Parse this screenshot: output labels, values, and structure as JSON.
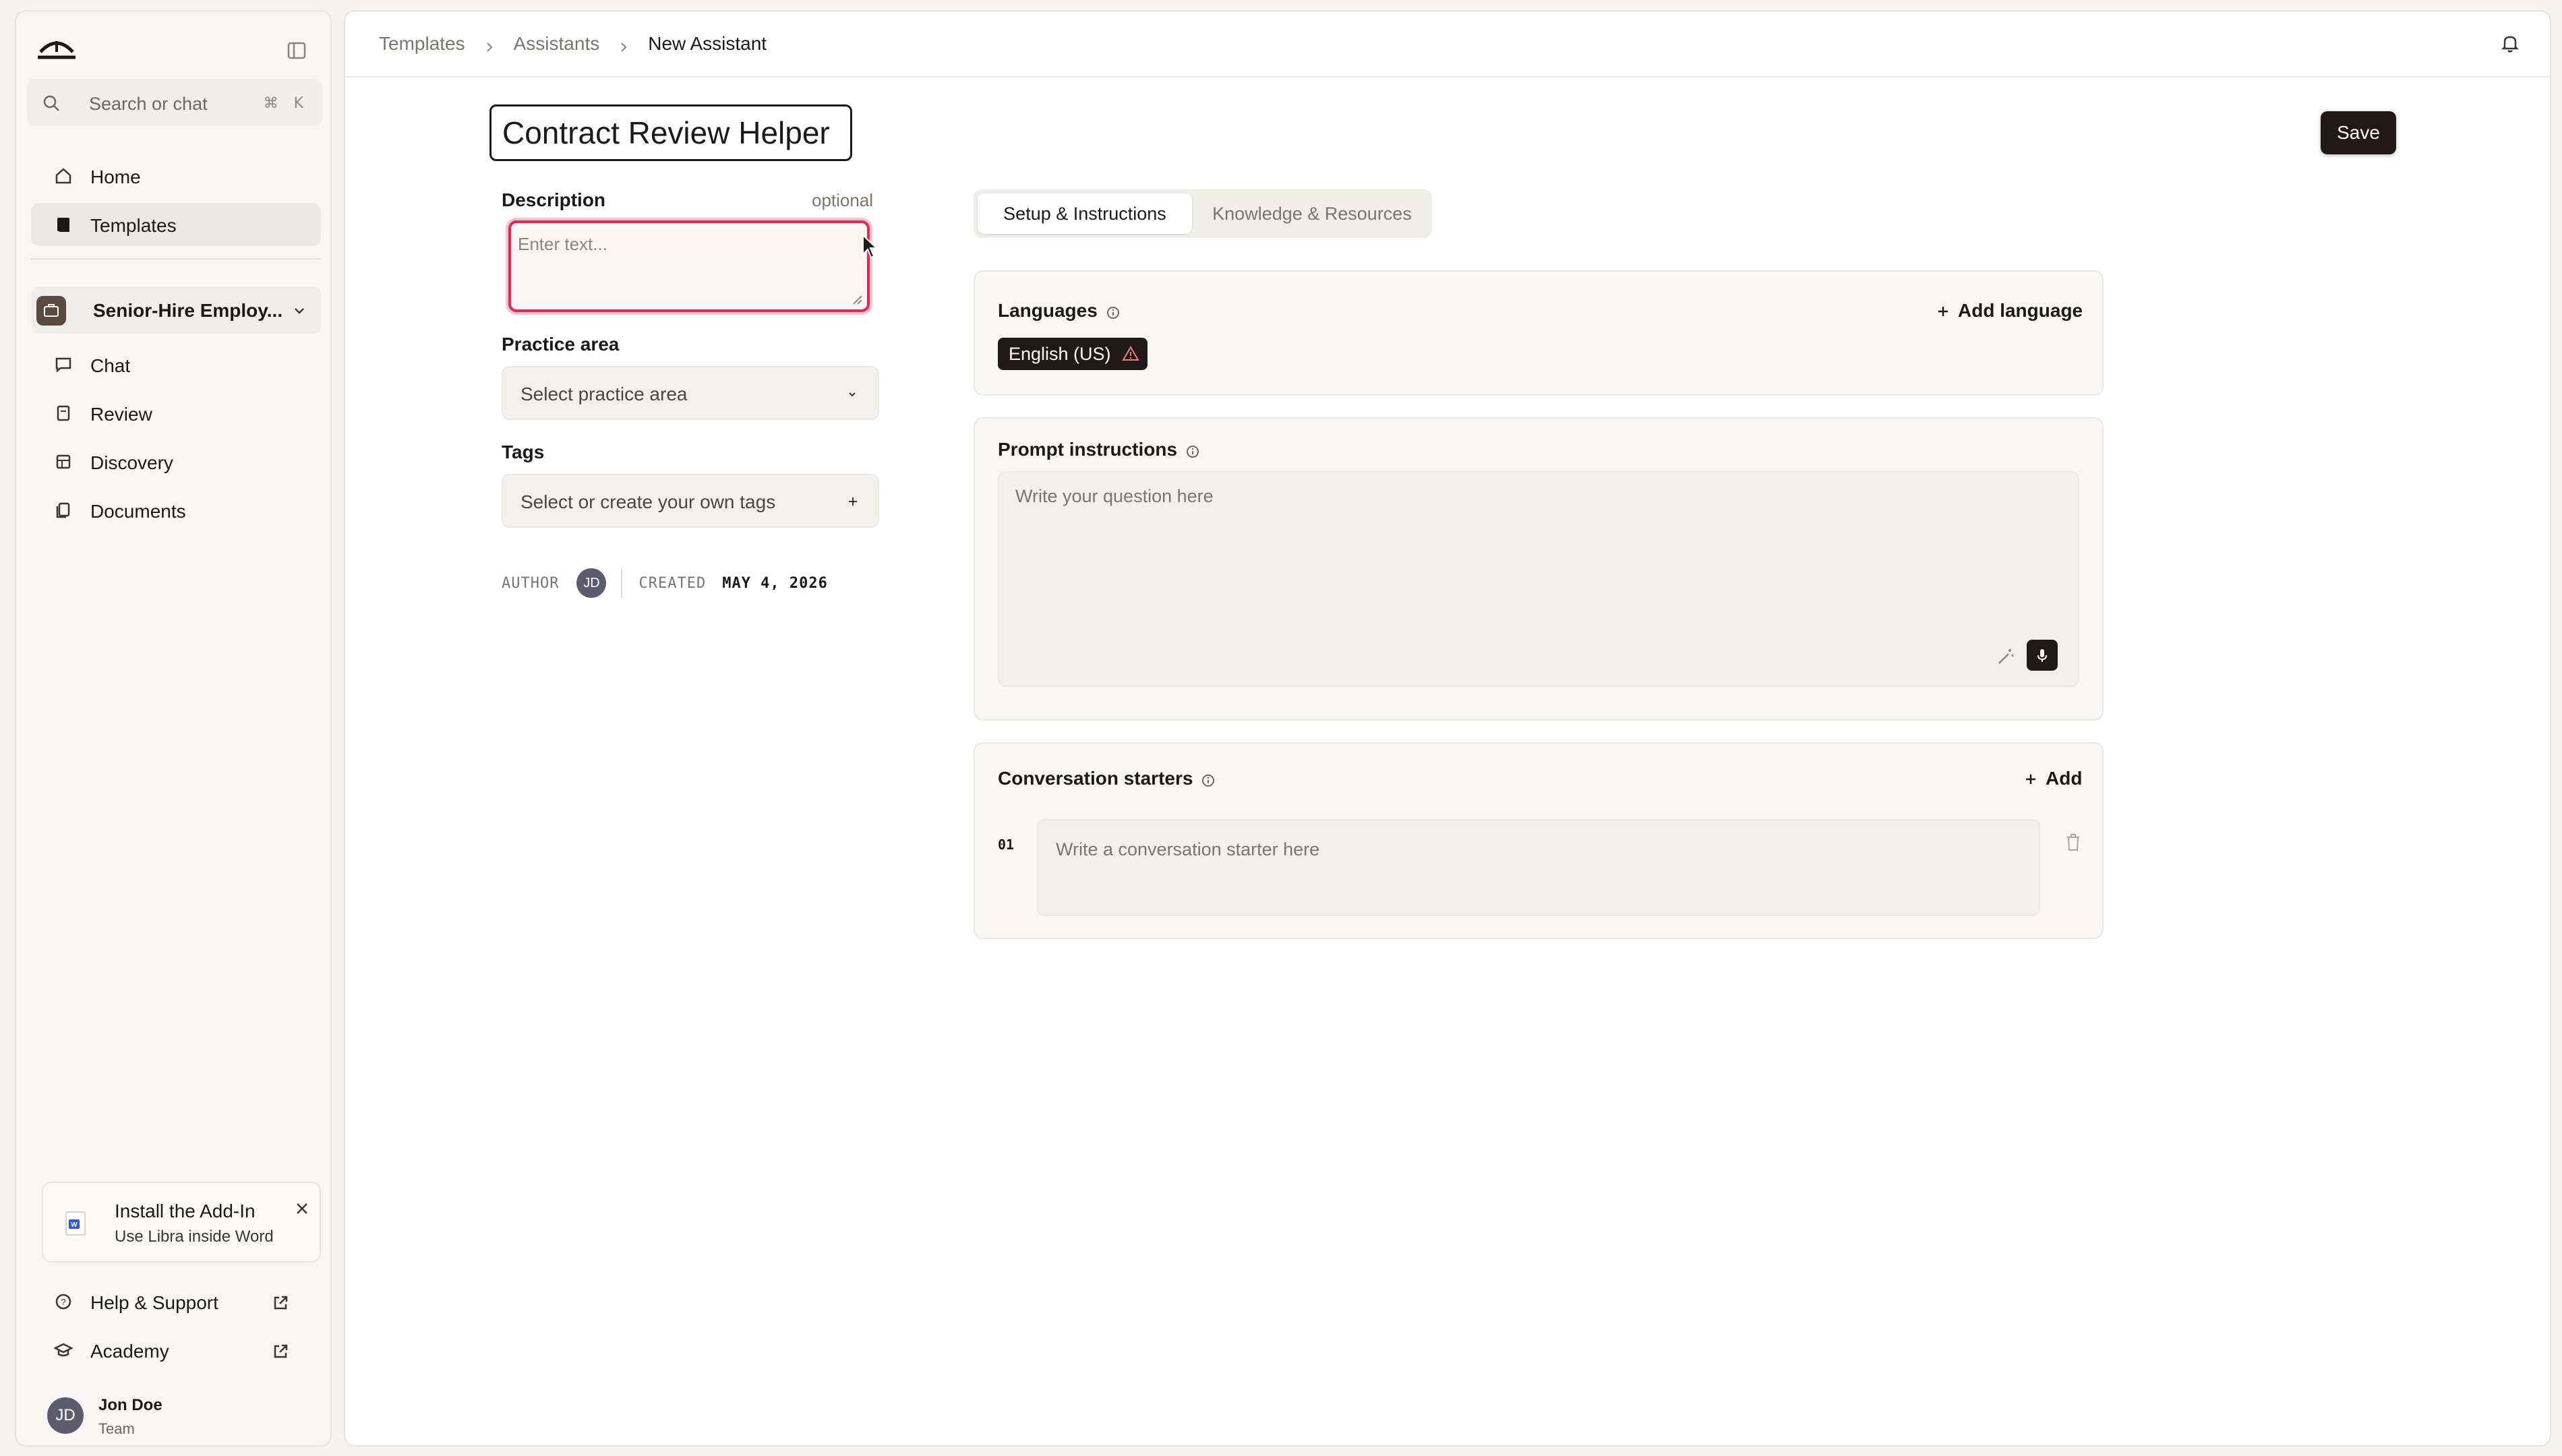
{
  "sidebar": {
    "search_placeholder": "Search or chat",
    "search_shortcut": "⌘ K",
    "nav": [
      {
        "label": "Home",
        "icon": "home-icon"
      },
      {
        "label": "Templates",
        "icon": "book-icon",
        "active": true
      }
    ],
    "workspace": {
      "label": "Senior-Hire Employ...",
      "icon": "briefcase-icon"
    },
    "workspace_nav": [
      {
        "label": "Chat",
        "icon": "chat-icon"
      },
      {
        "label": "Review",
        "icon": "review-icon"
      },
      {
        "label": "Discovery",
        "icon": "table-icon"
      },
      {
        "label": "Documents",
        "icon": "documents-icon"
      }
    ],
    "addin": {
      "title": "Install the Add-In",
      "subtitle": "Use Libra inside Word"
    },
    "footer_links": [
      {
        "label": "Help & Support",
        "icon": "help-icon"
      },
      {
        "label": "Academy",
        "icon": "graduation-cap-icon"
      }
    ],
    "user": {
      "initials": "JD",
      "name": "Jon Doe",
      "role": "Team"
    }
  },
  "breadcrumb": [
    "Templates",
    "Assistants",
    "New Assistant"
  ],
  "form": {
    "title_value": "Contract Review Helper",
    "save_label": "Save",
    "description_label": "Description",
    "description_optional": "optional",
    "description_placeholder": "Enter text...",
    "practice_label": "Practice area",
    "practice_placeholder": "Select practice area",
    "tags_label": "Tags",
    "tags_placeholder": "Select or create your own tags",
    "meta": {
      "author_label": "AUTHOR",
      "author_initials": "JD",
      "created_label": "CREATED",
      "created_value": "MAY 4, 2026"
    }
  },
  "tabs": [
    {
      "label": "Setup & Instructions",
      "active": true
    },
    {
      "label": "Knowledge & Resources",
      "active": false
    }
  ],
  "languages": {
    "title": "Languages",
    "add_label": "Add language",
    "chips": [
      "English (US)"
    ]
  },
  "prompt": {
    "title": "Prompt instructions",
    "placeholder": "Write your question here"
  },
  "starters": {
    "title": "Conversation starters",
    "add_label": "Add",
    "items": [
      {
        "num": "01",
        "placeholder": "Write a conversation starter here"
      }
    ]
  },
  "colors": {
    "accent_dark": "#1f1a17",
    "error_outline": "#e8264f",
    "background": "#f4f3f1"
  }
}
